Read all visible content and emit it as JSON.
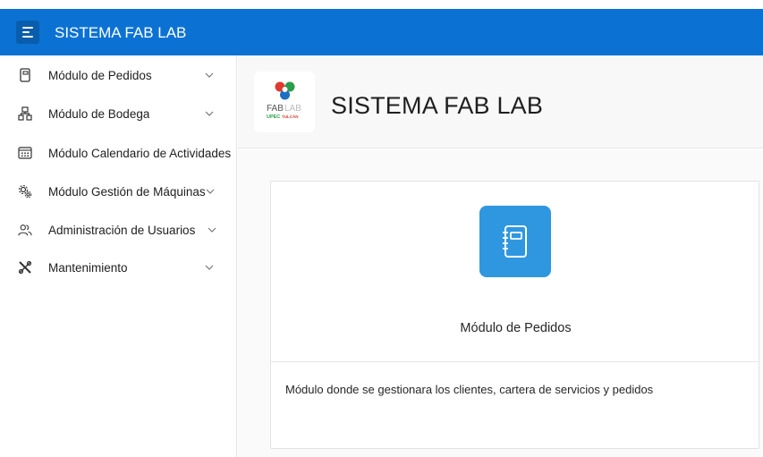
{
  "app": {
    "title": "SISTEMA FAB LAB"
  },
  "sidebar": {
    "items": [
      {
        "label": "Módulo de Pedidos",
        "icon": "notebook-icon",
        "expandable": true
      },
      {
        "label": "Módulo de Bodega",
        "icon": "sitemap-icon",
        "expandable": true
      },
      {
        "label": "Módulo Calendario de Actividades",
        "icon": "calendar-icon",
        "expandable": false
      },
      {
        "label": "Módulo Gestión de Máquinas",
        "icon": "gears-icon",
        "expandable": true
      },
      {
        "label": "Administración de Usuarios",
        "icon": "users-icon",
        "expandable": true
      },
      {
        "label": "Mantenimiento",
        "icon": "tools-icon",
        "expandable": true
      }
    ]
  },
  "header": {
    "logo_text": "FAB LAB",
    "logo_sub": "UPEC TULCÁN",
    "page_title": "SISTEMA FAB LAB"
  },
  "card": {
    "icon": "notebook-icon",
    "title": "Módulo de Pedidos",
    "description": "Módulo donde se gestionara los clientes, cartera de servicios y pedidos"
  },
  "colors": {
    "topbar": "#0b72d4",
    "card_icon_bg": "#2f97e0"
  }
}
